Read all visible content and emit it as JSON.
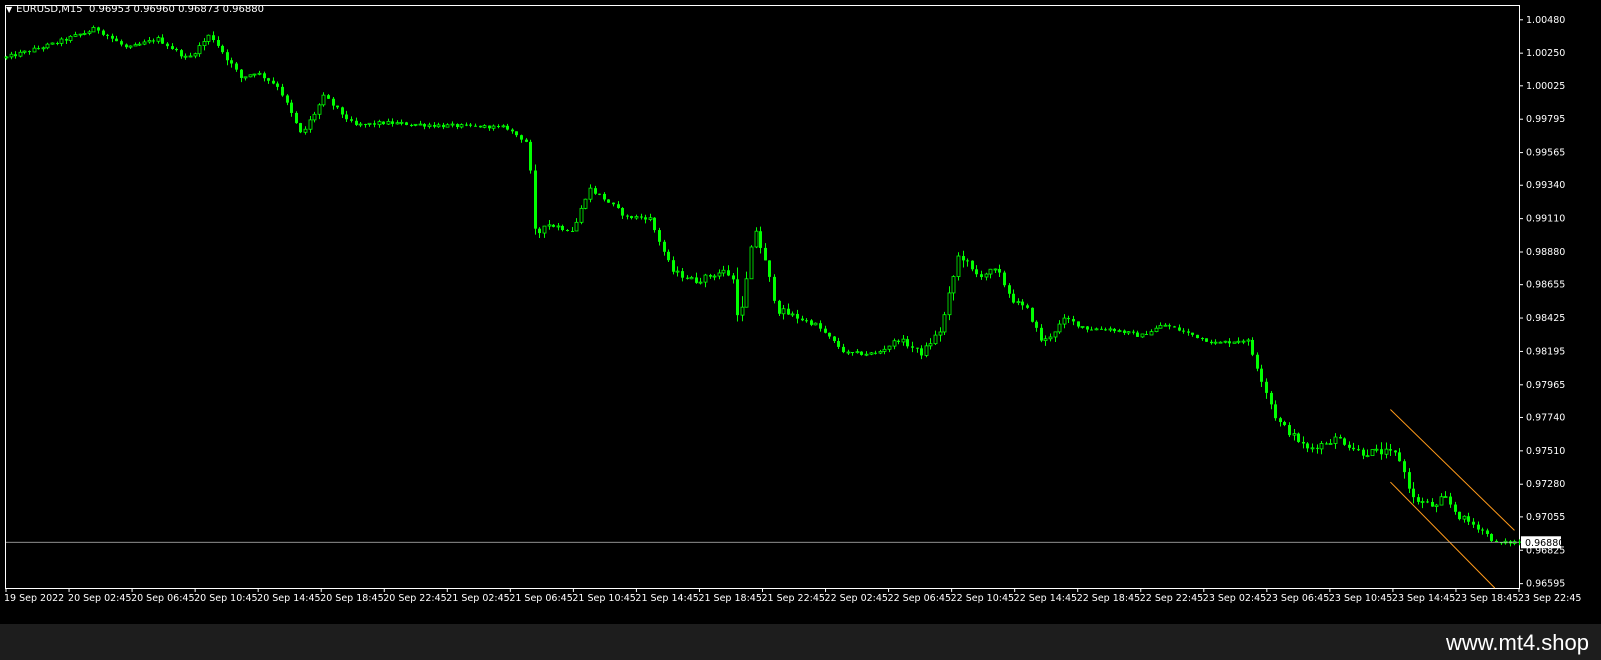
{
  "chart_header": {
    "symbol": "EURUSD,M15",
    "ohlc": "0.96953 0.96960 0.96873 0.96880"
  },
  "watermark": "www.mt4.shop",
  "colors": {
    "background": "#000000",
    "candle": "#00ff00",
    "axis": "#ffffff",
    "price_line": "#c0c0c0",
    "channel": "#ff9a1a"
  },
  "chart_data": {
    "type": "candlestick",
    "symbol": "EURUSD",
    "timeframe": "M15",
    "y_ticks": [
      "1.00480",
      "1.00250",
      "1.00025",
      "0.99795",
      "0.99565",
      "0.99340",
      "0.99110",
      "0.98880",
      "0.98655",
      "0.98425",
      "0.98195",
      "0.97965",
      "0.97740",
      "0.97510",
      "0.97280",
      "0.97055",
      "0.96825",
      "0.96595"
    ],
    "ylim": [
      0.96565,
      1.00575
    ],
    "x_ticks": [
      "19 Sep 2022",
      "20 Sep 02:45",
      "20 Sep 06:45",
      "20 Sep 10:45",
      "20 Sep 14:45",
      "20 Sep 18:45",
      "20 Sep 22:45",
      "21 Sep 02:45",
      "21 Sep 06:45",
      "21 Sep 10:45",
      "21 Sep 14:45",
      "21 Sep 18:45",
      "21 Sep 22:45",
      "22 Sep 02:45",
      "22 Sep 06:45",
      "22 Sep 10:45",
      "22 Sep 14:45",
      "22 Sep 18:45",
      "22 Sep 22:45",
      "23 Sep 02:45",
      "23 Sep 06:45",
      "23 Sep 10:45",
      "23 Sep 14:45",
      "23 Sep 18:45",
      "23 Sep 22:45"
    ],
    "current_price": "0.96880",
    "path_x": [
      0,
      0.03,
      0.06,
      0.08,
      0.1,
      0.12,
      0.135,
      0.155,
      0.165,
      0.18,
      0.195,
      0.21,
      0.23,
      0.25,
      0.29,
      0.33,
      0.345,
      0.35,
      0.355,
      0.375,
      0.385,
      0.395,
      0.41,
      0.425,
      0.44,
      0.455,
      0.475,
      0.48,
      0.485,
      0.495,
      0.51,
      0.535,
      0.555,
      0.575,
      0.59,
      0.605,
      0.618,
      0.63,
      0.64,
      0.655,
      0.665,
      0.675,
      0.685,
      0.7,
      0.715,
      0.73,
      0.75,
      0.765,
      0.8,
      0.82,
      0.84,
      0.85,
      0.86,
      0.88,
      0.895,
      0.91,
      0.92,
      0.93,
      0.945,
      0.95,
      0.96,
      0.975,
      0.985,
      0.995,
      1.0
    ],
    "path_close": [
      1.0022,
      1.0031,
      1.0042,
      1.0028,
      1.0035,
      1.0021,
      1.0038,
      1.0008,
      1.0012,
      1.0002,
      0.9968,
      0.9995,
      0.9975,
      0.9977,
      0.9975,
      0.9974,
      0.9963,
      0.9895,
      0.9908,
      0.9903,
      0.9932,
      0.9925,
      0.9912,
      0.9912,
      0.9875,
      0.9868,
      0.9875,
      0.987,
      0.9838,
      0.9905,
      0.9848,
      0.9838,
      0.9818,
      0.9818,
      0.9828,
      0.9818,
      0.9835,
      0.9888,
      0.9872,
      0.9875,
      0.9855,
      0.9848,
      0.9825,
      0.9842,
      0.9835,
      0.9835,
      0.983,
      0.9838,
      0.9825,
      0.9828,
      0.9772,
      0.9762,
      0.9752,
      0.976,
      0.975,
      0.975,
      0.9748,
      0.9718,
      0.9712,
      0.972,
      0.9706,
      0.9697,
      0.9687,
      0.9688,
      0.9688
    ],
    "volatility": [
      0.0003,
      0.0003,
      0.0004,
      0.0003,
      0.0003,
      0.0003,
      0.0005,
      0.0004,
      0.0003,
      0.0003,
      0.0006,
      0.0004,
      0.0003,
      0.0003,
      0.0003,
      0.0002,
      0.0003,
      0.0007,
      0.0005,
      0.0004,
      0.0004,
      0.0004,
      0.0003,
      0.0004,
      0.0004,
      0.0005,
      0.0004,
      0.0008,
      0.0012,
      0.0009,
      0.0006,
      0.0003,
      0.0003,
      0.0003,
      0.0004,
      0.0004,
      0.0006,
      0.0007,
      0.0006,
      0.0005,
      0.0004,
      0.0004,
      0.0005,
      0.0004,
      0.0003,
      0.0003,
      0.0003,
      0.0003,
      0.0003,
      0.0004,
      0.0006,
      0.0005,
      0.0005,
      0.0005,
      0.0006,
      0.0006,
      0.0006,
      0.0006,
      0.0005,
      0.0005,
      0.0005,
      0.0004,
      0.0003,
      0.0003,
      0.0003
    ],
    "candle_count": 330,
    "channel": {
      "upper": [
        [
          0.915,
          0.97795
        ],
        [
          0.997,
          0.96962
        ]
      ],
      "lower": [
        [
          0.915,
          0.97295
        ],
        [
          0.984,
          0.96565
        ]
      ]
    }
  }
}
